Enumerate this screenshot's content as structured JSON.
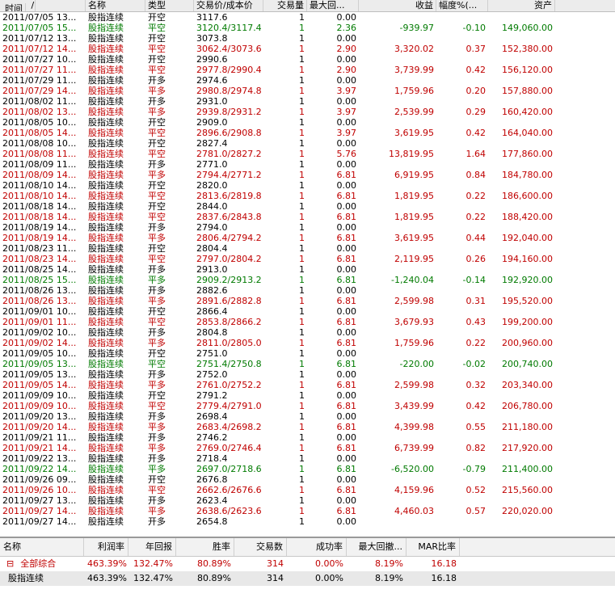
{
  "columns": [
    "时间",
    "名称",
    "类型",
    "交易价/成本价",
    "交易量",
    "最大回...",
    "收益",
    "幅度%(...",
    "资产"
  ],
  "sort_glyph": "/",
  "rows": [
    {
      "time": "2011/07/05 13...",
      "name": "股指连续",
      "type": "开空",
      "price": "3117.6",
      "vol": "1",
      "dd": "0.00",
      "profit": "",
      "pct": "",
      "asset": "",
      "color": "blk"
    },
    {
      "time": "2011/07/05 15...",
      "name": "股指连续",
      "type": "平空",
      "price": "3120.4/3117.4",
      "vol": "1",
      "dd": "2.36",
      "profit": "-939.97",
      "pct": "-0.10",
      "asset": "149,060.00",
      "color": "green"
    },
    {
      "time": "2011/07/12 13...",
      "name": "股指连续",
      "type": "开空",
      "price": "3073.8",
      "vol": "1",
      "dd": "0.00",
      "profit": "",
      "pct": "",
      "asset": "",
      "color": "blk"
    },
    {
      "time": "2011/07/12 14...",
      "name": "股指连续",
      "type": "平空",
      "price": "3062.4/3073.6",
      "vol": "1",
      "dd": "2.90",
      "profit": "3,320.02",
      "pct": "0.37",
      "asset": "152,380.00",
      "color": "red"
    },
    {
      "time": "2011/07/27 10...",
      "name": "股指连续",
      "type": "开空",
      "price": "2990.6",
      "vol": "1",
      "dd": "0.00",
      "profit": "",
      "pct": "",
      "asset": "",
      "color": "blk"
    },
    {
      "time": "2011/07/27 11...",
      "name": "股指连续",
      "type": "平空",
      "price": "2977.8/2990.4",
      "vol": "1",
      "dd": "2.90",
      "profit": "3,739.99",
      "pct": "0.42",
      "asset": "156,120.00",
      "color": "red"
    },
    {
      "time": "2011/07/29 11...",
      "name": "股指连续",
      "type": "开多",
      "price": "2974.6",
      "vol": "1",
      "dd": "0.00",
      "profit": "",
      "pct": "",
      "asset": "",
      "color": "blk"
    },
    {
      "time": "2011/07/29 14...",
      "name": "股指连续",
      "type": "平多",
      "price": "2980.8/2974.8",
      "vol": "1",
      "dd": "3.97",
      "profit": "1,759.96",
      "pct": "0.20",
      "asset": "157,880.00",
      "color": "red"
    },
    {
      "time": "2011/08/02 11...",
      "name": "股指连续",
      "type": "开多",
      "price": "2931.0",
      "vol": "1",
      "dd": "0.00",
      "profit": "",
      "pct": "",
      "asset": "",
      "color": "blk"
    },
    {
      "time": "2011/08/02 13...",
      "name": "股指连续",
      "type": "平多",
      "price": "2939.8/2931.2",
      "vol": "1",
      "dd": "3.97",
      "profit": "2,539.99",
      "pct": "0.29",
      "asset": "160,420.00",
      "color": "red"
    },
    {
      "time": "2011/08/05 10...",
      "name": "股指连续",
      "type": "开空",
      "price": "2909.0",
      "vol": "1",
      "dd": "0.00",
      "profit": "",
      "pct": "",
      "asset": "",
      "color": "blk"
    },
    {
      "time": "2011/08/05 14...",
      "name": "股指连续",
      "type": "平空",
      "price": "2896.6/2908.8",
      "vol": "1",
      "dd": "3.97",
      "profit": "3,619.95",
      "pct": "0.42",
      "asset": "164,040.00",
      "color": "red"
    },
    {
      "time": "2011/08/08 10...",
      "name": "股指连续",
      "type": "开空",
      "price": "2827.4",
      "vol": "1",
      "dd": "0.00",
      "profit": "",
      "pct": "",
      "asset": "",
      "color": "blk"
    },
    {
      "time": "2011/08/08 11...",
      "name": "股指连续",
      "type": "平空",
      "price": "2781.0/2827.2",
      "vol": "1",
      "dd": "5.76",
      "profit": "13,819.95",
      "pct": "1.64",
      "asset": "177,860.00",
      "color": "red"
    },
    {
      "time": "2011/08/09 11...",
      "name": "股指连续",
      "type": "开多",
      "price": "2771.0",
      "vol": "1",
      "dd": "0.00",
      "profit": "",
      "pct": "",
      "asset": "",
      "color": "blk"
    },
    {
      "time": "2011/08/09 14...",
      "name": "股指连续",
      "type": "平多",
      "price": "2794.4/2771.2",
      "vol": "1",
      "dd": "6.81",
      "profit": "6,919.95",
      "pct": "0.84",
      "asset": "184,780.00",
      "color": "red"
    },
    {
      "time": "2011/08/10 14...",
      "name": "股指连续",
      "type": "开空",
      "price": "2820.0",
      "vol": "1",
      "dd": "0.00",
      "profit": "",
      "pct": "",
      "asset": "",
      "color": "blk"
    },
    {
      "time": "2011/08/10 14...",
      "name": "股指连续",
      "type": "平空",
      "price": "2813.6/2819.8",
      "vol": "1",
      "dd": "6.81",
      "profit": "1,819.95",
      "pct": "0.22",
      "asset": "186,600.00",
      "color": "red"
    },
    {
      "time": "2011/08/18 14...",
      "name": "股指连续",
      "type": "开空",
      "price": "2844.0",
      "vol": "1",
      "dd": "0.00",
      "profit": "",
      "pct": "",
      "asset": "",
      "color": "blk"
    },
    {
      "time": "2011/08/18 14...",
      "name": "股指连续",
      "type": "平空",
      "price": "2837.6/2843.8",
      "vol": "1",
      "dd": "6.81",
      "profit": "1,819.95",
      "pct": "0.22",
      "asset": "188,420.00",
      "color": "red"
    },
    {
      "time": "2011/08/19 14...",
      "name": "股指连续",
      "type": "开多",
      "price": "2794.0",
      "vol": "1",
      "dd": "0.00",
      "profit": "",
      "pct": "",
      "asset": "",
      "color": "blk"
    },
    {
      "time": "2011/08/19 14...",
      "name": "股指连续",
      "type": "平多",
      "price": "2806.4/2794.2",
      "vol": "1",
      "dd": "6.81",
      "profit": "3,619.95",
      "pct": "0.44",
      "asset": "192,040.00",
      "color": "red"
    },
    {
      "time": "2011/08/23 11...",
      "name": "股指连续",
      "type": "开空",
      "price": "2804.4",
      "vol": "1",
      "dd": "0.00",
      "profit": "",
      "pct": "",
      "asset": "",
      "color": "blk"
    },
    {
      "time": "2011/08/23 14...",
      "name": "股指连续",
      "type": "平空",
      "price": "2797.0/2804.2",
      "vol": "1",
      "dd": "6.81",
      "profit": "2,119.95",
      "pct": "0.26",
      "asset": "194,160.00",
      "color": "red"
    },
    {
      "time": "2011/08/25 14...",
      "name": "股指连续",
      "type": "开多",
      "price": "2913.0",
      "vol": "1",
      "dd": "0.00",
      "profit": "",
      "pct": "",
      "asset": "",
      "color": "blk"
    },
    {
      "time": "2011/08/25 15...",
      "name": "股指连续",
      "type": "平多",
      "price": "2909.2/2913.2",
      "vol": "1",
      "dd": "6.81",
      "profit": "-1,240.04",
      "pct": "-0.14",
      "asset": "192,920.00",
      "color": "green"
    },
    {
      "time": "2011/08/26 13...",
      "name": "股指连续",
      "type": "开多",
      "price": "2882.6",
      "vol": "1",
      "dd": "0.00",
      "profit": "",
      "pct": "",
      "asset": "",
      "color": "blk"
    },
    {
      "time": "2011/08/26 13...",
      "name": "股指连续",
      "type": "平多",
      "price": "2891.6/2882.8",
      "vol": "1",
      "dd": "6.81",
      "profit": "2,599.98",
      "pct": "0.31",
      "asset": "195,520.00",
      "color": "red"
    },
    {
      "time": "2011/09/01 10...",
      "name": "股指连续",
      "type": "开空",
      "price": "2866.4",
      "vol": "1",
      "dd": "0.00",
      "profit": "",
      "pct": "",
      "asset": "",
      "color": "blk"
    },
    {
      "time": "2011/09/01 11...",
      "name": "股指连续",
      "type": "平空",
      "price": "2853.8/2866.2",
      "vol": "1",
      "dd": "6.81",
      "profit": "3,679.93",
      "pct": "0.43",
      "asset": "199,200.00",
      "color": "red"
    },
    {
      "time": "2011/09/02 10...",
      "name": "股指连续",
      "type": "开多",
      "price": "2804.8",
      "vol": "1",
      "dd": "0.00",
      "profit": "",
      "pct": "",
      "asset": "",
      "color": "blk"
    },
    {
      "time": "2011/09/02 14...",
      "name": "股指连续",
      "type": "平多",
      "price": "2811.0/2805.0",
      "vol": "1",
      "dd": "6.81",
      "profit": "1,759.96",
      "pct": "0.22",
      "asset": "200,960.00",
      "color": "red"
    },
    {
      "time": "2011/09/05 10...",
      "name": "股指连续",
      "type": "开空",
      "price": "2751.0",
      "vol": "1",
      "dd": "0.00",
      "profit": "",
      "pct": "",
      "asset": "",
      "color": "blk"
    },
    {
      "time": "2011/09/05 13...",
      "name": "股指连续",
      "type": "平空",
      "price": "2751.4/2750.8",
      "vol": "1",
      "dd": "6.81",
      "profit": "-220.00",
      "pct": "-0.02",
      "asset": "200,740.00",
      "color": "green"
    },
    {
      "time": "2011/09/05 13...",
      "name": "股指连续",
      "type": "开多",
      "price": "2752.0",
      "vol": "1",
      "dd": "0.00",
      "profit": "",
      "pct": "",
      "asset": "",
      "color": "blk"
    },
    {
      "time": "2011/09/05 14...",
      "name": "股指连续",
      "type": "平多",
      "price": "2761.0/2752.2",
      "vol": "1",
      "dd": "6.81",
      "profit": "2,599.98",
      "pct": "0.32",
      "asset": "203,340.00",
      "color": "red"
    },
    {
      "time": "2011/09/09 10...",
      "name": "股指连续",
      "type": "开空",
      "price": "2791.2",
      "vol": "1",
      "dd": "0.00",
      "profit": "",
      "pct": "",
      "asset": "",
      "color": "blk"
    },
    {
      "time": "2011/09/09 10...",
      "name": "股指连续",
      "type": "平空",
      "price": "2779.4/2791.0",
      "vol": "1",
      "dd": "6.81",
      "profit": "3,439.99",
      "pct": "0.42",
      "asset": "206,780.00",
      "color": "red"
    },
    {
      "time": "2011/09/20 13...",
      "name": "股指连续",
      "type": "开多",
      "price": "2698.4",
      "vol": "1",
      "dd": "0.00",
      "profit": "",
      "pct": "",
      "asset": "",
      "color": "blk"
    },
    {
      "time": "2011/09/20 14...",
      "name": "股指连续",
      "type": "平多",
      "price": "2683.4/2698.2",
      "vol": "1",
      "dd": "6.81",
      "profit": "4,399.98",
      "pct": "0.55",
      "asset": "211,180.00",
      "color": "red"
    },
    {
      "time": "2011/09/21 11...",
      "name": "股指连续",
      "type": "开多",
      "price": "2746.2",
      "vol": "1",
      "dd": "0.00",
      "profit": "",
      "pct": "",
      "asset": "",
      "color": "blk"
    },
    {
      "time": "2011/09/21 14...",
      "name": "股指连续",
      "type": "平多",
      "price": "2769.0/2746.4",
      "vol": "1",
      "dd": "6.81",
      "profit": "6,739.99",
      "pct": "0.82",
      "asset": "217,920.00",
      "color": "red"
    },
    {
      "time": "2011/09/22 13...",
      "name": "股指连续",
      "type": "开多",
      "price": "2718.4",
      "vol": "1",
      "dd": "0.00",
      "profit": "",
      "pct": "",
      "asset": "",
      "color": "blk"
    },
    {
      "time": "2011/09/22 14...",
      "name": "股指连续",
      "type": "平多",
      "price": "2697.0/2718.6",
      "vol": "1",
      "dd": "6.81",
      "profit": "-6,520.00",
      "pct": "-0.79",
      "asset": "211,400.00",
      "color": "green"
    },
    {
      "time": "2011/09/26 09...",
      "name": "股指连续",
      "type": "开空",
      "price": "2676.8",
      "vol": "1",
      "dd": "0.00",
      "profit": "",
      "pct": "",
      "asset": "",
      "color": "blk"
    },
    {
      "time": "2011/09/26 10...",
      "name": "股指连续",
      "type": "平空",
      "price": "2662.6/2676.6",
      "vol": "1",
      "dd": "6.81",
      "profit": "4,159.96",
      "pct": "0.52",
      "asset": "215,560.00",
      "color": "red"
    },
    {
      "time": "2011/09/27 13...",
      "name": "股指连续",
      "type": "开多",
      "price": "2623.4",
      "vol": "1",
      "dd": "0.00",
      "profit": "",
      "pct": "",
      "asset": "",
      "color": "blk"
    },
    {
      "time": "2011/09/27 14...",
      "name": "股指连续",
      "type": "平多",
      "price": "2638.6/2623.6",
      "vol": "1",
      "dd": "6.81",
      "profit": "4,460.03",
      "pct": "0.57",
      "asset": "220,020.00",
      "color": "red"
    },
    {
      "time": "2011/09/27 14...",
      "name": "股指连续",
      "type": "开多",
      "price": "2654.8",
      "vol": "1",
      "dd": "0.00",
      "profit": "",
      "pct": "",
      "asset": "",
      "color": "blk"
    }
  ],
  "summary": {
    "columns": [
      "名称",
      "利润率",
      "年回报",
      "胜率",
      "交易数",
      "成功率",
      "最大回撤...",
      "MAR比率"
    ],
    "rows": [
      {
        "name": "全部综合",
        "profit_rate": "463.39%",
        "annual": "132.47%",
        "win": "80.89%",
        "trades": "314",
        "success": "0.00%",
        "maxdd": "8.19%",
        "mar": "16.18",
        "color": "red",
        "fold_icon": "⊟"
      },
      {
        "name": "股指连续",
        "profit_rate": "463.39%",
        "annual": "132.47%",
        "win": "80.89%",
        "trades": "314",
        "success": "0.00%",
        "maxdd": "8.19%",
        "mar": "16.18",
        "color": "blk",
        "fold_icon": ""
      }
    ]
  }
}
